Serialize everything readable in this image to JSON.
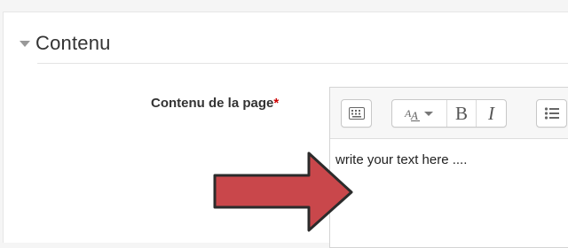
{
  "section": {
    "title": "Contenu"
  },
  "field": {
    "label": "Contenu de la page",
    "required_marker": "*"
  },
  "editor": {
    "toolbar": {
      "buttons": [
        {
          "name": "toolbar-toggle",
          "icon": "keyboard-icon"
        },
        {
          "name": "font-style",
          "icon": "font-style-icon",
          "glyph": "A"
        },
        {
          "name": "bold",
          "label": "B"
        },
        {
          "name": "italic",
          "label": "I"
        },
        {
          "name": "unordered-list",
          "icon": "list-icon"
        }
      ]
    },
    "content": "write your text here ...."
  },
  "colors": {
    "arrow_fill": "#c9474b",
    "arrow_stroke": "#2b2b2b",
    "required": "#cc0000"
  }
}
